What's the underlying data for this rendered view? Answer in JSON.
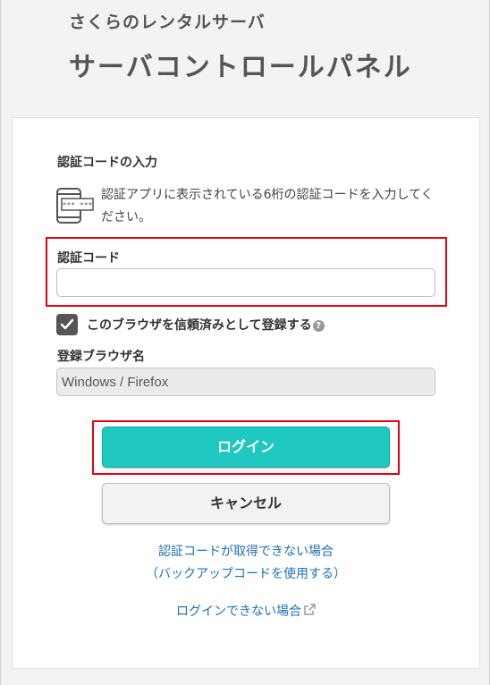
{
  "header": {
    "service_name": "さくらのレンタルサーバ",
    "panel_title": "サーバコントロールパネル"
  },
  "form": {
    "section_title": "認証コードの入力",
    "instruction": "認証アプリに表示されている6桁の認証コードを入力してください。",
    "phone_icon_text": "*** ***",
    "code_label": "認証コード",
    "code_value": "",
    "code_placeholder": "",
    "trust_checkbox_label": "このブラウザを信頼済みとして登録する",
    "trust_checkbox_checked": true,
    "help_icon_glyph": "?",
    "browser_name_label": "登録ブラウザ名",
    "browser_name_value": "Windows / Firefox"
  },
  "buttons": {
    "login_label": "ログイン",
    "cancel_label": "キャンセル"
  },
  "links": {
    "no_code_line1": "認証コードが取得できない場合",
    "no_code_line2": "（バックアップコードを使用する）",
    "cant_login": "ログインできない場合"
  },
  "colors": {
    "accent": "#1fc8c1",
    "highlight": "#e60012",
    "link": "#2070b8"
  },
  "icons": {
    "phone": "phone-icon",
    "check": "check-icon",
    "help": "help-icon",
    "external": "external-link-icon"
  }
}
